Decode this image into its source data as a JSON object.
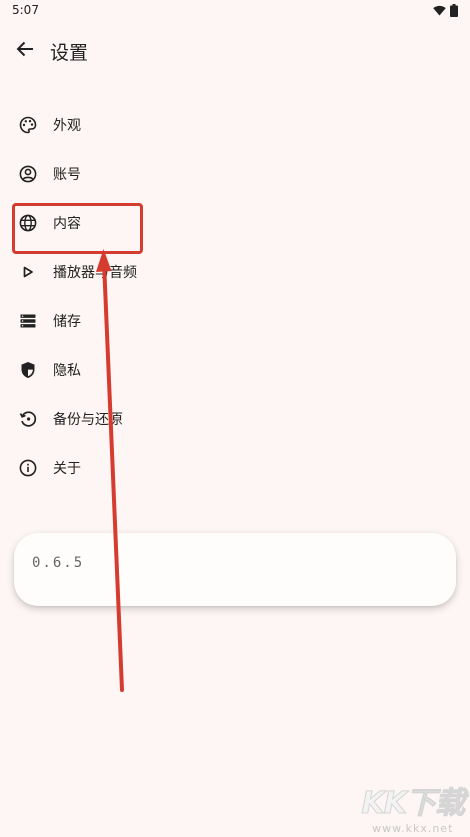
{
  "status_bar": {
    "time": "5:07"
  },
  "header": {
    "title": "设置"
  },
  "menu": [
    {
      "label": "外观",
      "icon": "palette-icon"
    },
    {
      "label": "账号",
      "icon": "account-circle-icon"
    },
    {
      "label": "内容",
      "icon": "globe-icon"
    },
    {
      "label": "播放器与音频",
      "icon": "play-icon"
    },
    {
      "label": "储存",
      "icon": "storage-icon"
    },
    {
      "label": "隐私",
      "icon": "shield-icon"
    },
    {
      "label": "备份与还原",
      "icon": "restore-icon"
    },
    {
      "label": "关于",
      "icon": "info-icon"
    }
  ],
  "version": "0.6.5",
  "watermark": {
    "logo": "KK下载",
    "url": "www.kkx.net"
  },
  "colors": {
    "background": "#fdf6f4",
    "annotation": "#d63b2f"
  }
}
